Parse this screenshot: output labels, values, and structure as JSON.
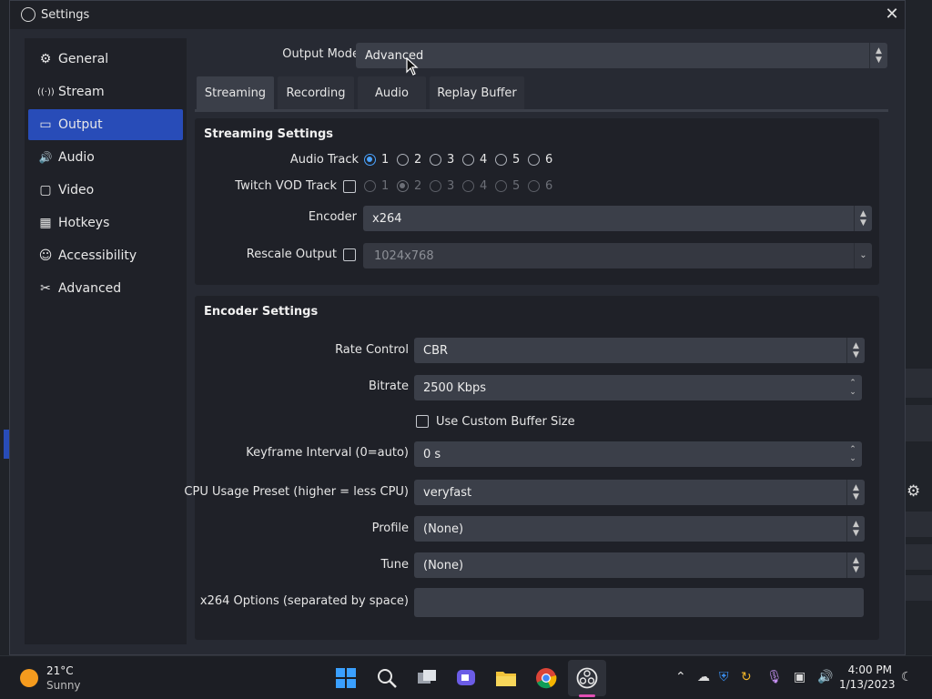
{
  "window": {
    "title": "Settings",
    "close": "✕"
  },
  "sidebar": {
    "items": [
      {
        "label": "General",
        "icon": "⚙"
      },
      {
        "label": "Stream",
        "icon": "((·))"
      },
      {
        "label": "Output",
        "icon": "▭"
      },
      {
        "label": "Audio",
        "icon": "🔊"
      },
      {
        "label": "Video",
        "icon": "▢"
      },
      {
        "label": "Hotkeys",
        "icon": "▦"
      },
      {
        "label": "Accessibility",
        "icon": "☺"
      },
      {
        "label": "Advanced",
        "icon": "✂"
      }
    ],
    "active": "Output"
  },
  "output_mode": {
    "label": "Output Mode",
    "value": "Advanced"
  },
  "tabs": [
    "Streaming",
    "Recording",
    "Audio",
    "Replay Buffer"
  ],
  "streaming": {
    "title": "Streaming Settings",
    "audio_track_label": "Audio Track",
    "tracks": [
      "1",
      "2",
      "3",
      "4",
      "5",
      "6"
    ],
    "twitch_label": "Twitch VOD Track",
    "encoder_label": "Encoder",
    "encoder_value": "x264",
    "rescale_label": "Rescale Output",
    "rescale_value": "1024x768"
  },
  "encoder": {
    "title": "Encoder Settings",
    "rate_control_label": "Rate Control",
    "rate_control_value": "CBR",
    "bitrate_label": "Bitrate",
    "bitrate_value": "2500 Kbps",
    "custom_buffer_label": "Use Custom Buffer Size",
    "keyframe_label": "Keyframe Interval (0=auto)",
    "keyframe_value": "0 s",
    "cpu_label": "CPU Usage Preset (higher = less CPU)",
    "cpu_value": "veryfast",
    "profile_label": "Profile",
    "profile_value": "(None)",
    "tune_label": "Tune",
    "tune_value": "(None)",
    "options_label": "x264 Options (separated by space)",
    "options_value": ""
  },
  "taskbar": {
    "weather_temp": "21°C",
    "weather_desc": "Sunny",
    "time": "4:00 PM",
    "date": "1/13/2023"
  }
}
